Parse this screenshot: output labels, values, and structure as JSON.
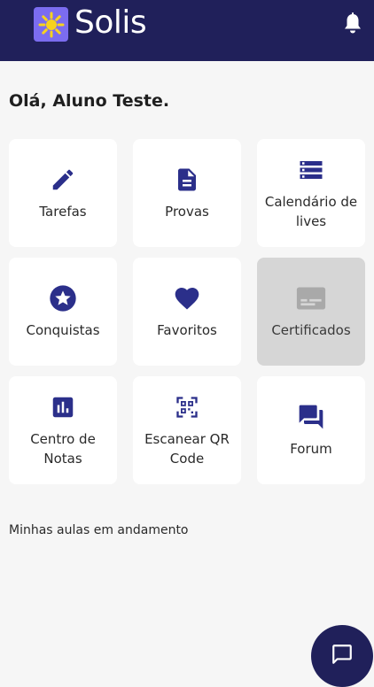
{
  "app": {
    "name": "Solis"
  },
  "greeting": "Olá, Aluno Teste.",
  "tiles": [
    {
      "label": "Tarefas",
      "icon": "pencil-icon",
      "enabled": true
    },
    {
      "label": "Provas",
      "icon": "document-icon",
      "enabled": true
    },
    {
      "label": "Calendário de lives",
      "icon": "storage-icon",
      "enabled": true
    },
    {
      "label": "Conquistas",
      "icon": "star-badge-icon",
      "enabled": true
    },
    {
      "label": "Favoritos",
      "icon": "heart-icon",
      "enabled": true
    },
    {
      "label": "Certificados",
      "icon": "card-icon",
      "enabled": false
    },
    {
      "label": "Centro de Notas",
      "icon": "bar-chart-icon",
      "enabled": true
    },
    {
      "label": "Escanear QR Code",
      "icon": "qr-scan-icon",
      "enabled": true
    },
    {
      "label": "Forum",
      "icon": "forum-icon",
      "enabled": true
    }
  ],
  "section": {
    "in_progress_title": "Minhas aulas em andamento"
  },
  "colors": {
    "header_bg": "#20205a",
    "icon_blue": "#2b2f8a",
    "logo_bg": "#7b6cf0",
    "logo_sun": "#f7d21e",
    "page_bg": "#f6f6f6",
    "disabled_tile": "#d6d6d6"
  },
  "icons": {
    "header_right": "bell-icon",
    "fab": "chat-icon",
    "logo": "sun-logo-icon"
  }
}
